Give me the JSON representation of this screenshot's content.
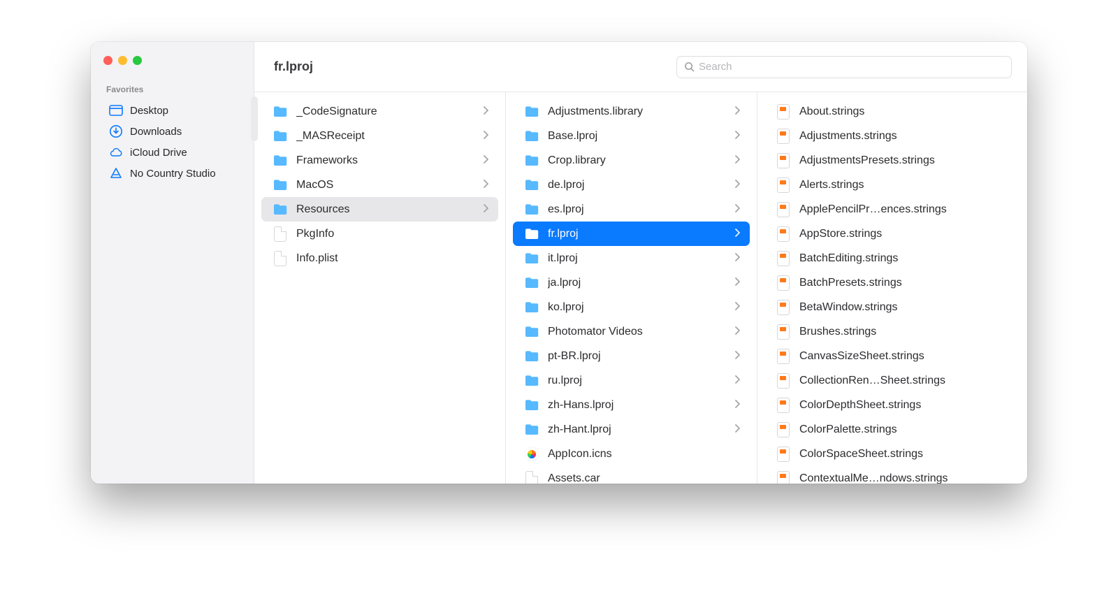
{
  "window_title": "fr.lproj",
  "search": {
    "placeholder": "Search"
  },
  "sidebar": {
    "favorites_label": "Favorites",
    "items": [
      {
        "label": "Desktop",
        "icon": "desktop-icon"
      },
      {
        "label": "Downloads",
        "icon": "downloads-icon"
      },
      {
        "label": "iCloud Drive",
        "icon": "icloud-icon"
      },
      {
        "label": "No Country Studio",
        "icon": "triangle-icon"
      }
    ]
  },
  "columns": [
    {
      "items": [
        {
          "label": "_CodeSignature",
          "kind": "folder",
          "chev": true
        },
        {
          "label": "_MASReceipt",
          "kind": "folder",
          "chev": true
        },
        {
          "label": "Frameworks",
          "kind": "folder",
          "chev": true
        },
        {
          "label": "MacOS",
          "kind": "folder",
          "chev": true
        },
        {
          "label": "Resources",
          "kind": "folder",
          "chev": true,
          "openpath": true
        },
        {
          "label": "PkgInfo",
          "kind": "file"
        },
        {
          "label": "Info.plist",
          "kind": "file"
        }
      ]
    },
    {
      "items": [
        {
          "label": "Adjustments.library",
          "kind": "folder",
          "chev": true
        },
        {
          "label": "Base.lproj",
          "kind": "folder",
          "chev": true
        },
        {
          "label": "Crop.library",
          "kind": "folder",
          "chev": true
        },
        {
          "label": "de.lproj",
          "kind": "folder",
          "chev": true
        },
        {
          "label": "es.lproj",
          "kind": "folder",
          "chev": true
        },
        {
          "label": "fr.lproj",
          "kind": "folder",
          "chev": true,
          "selected": true
        },
        {
          "label": "it.lproj",
          "kind": "folder",
          "chev": true
        },
        {
          "label": "ja.lproj",
          "kind": "folder",
          "chev": true
        },
        {
          "label": "ko.lproj",
          "kind": "folder",
          "chev": true
        },
        {
          "label": "Photomator Videos",
          "kind": "folder",
          "chev": true
        },
        {
          "label": "pt-BR.lproj",
          "kind": "folder",
          "chev": true
        },
        {
          "label": "ru.lproj",
          "kind": "folder",
          "chev": true
        },
        {
          "label": "zh-Hans.lproj",
          "kind": "folder",
          "chev": true
        },
        {
          "label": "zh-Hant.lproj",
          "kind": "folder",
          "chev": true
        },
        {
          "label": "AppIcon.icns",
          "kind": "icns"
        },
        {
          "label": "Assets.car",
          "kind": "file"
        }
      ]
    },
    {
      "items": [
        {
          "label": "About.strings",
          "kind": "strings"
        },
        {
          "label": "Adjustments.strings",
          "kind": "strings"
        },
        {
          "label": "AdjustmentsPresets.strings",
          "kind": "strings"
        },
        {
          "label": "Alerts.strings",
          "kind": "strings"
        },
        {
          "label": "ApplePencilPr…ences.strings",
          "kind": "strings"
        },
        {
          "label": "AppStore.strings",
          "kind": "strings"
        },
        {
          "label": "BatchEditing.strings",
          "kind": "strings"
        },
        {
          "label": "BatchPresets.strings",
          "kind": "strings"
        },
        {
          "label": "BetaWindow.strings",
          "kind": "strings"
        },
        {
          "label": "Brushes.strings",
          "kind": "strings"
        },
        {
          "label": "CanvasSizeSheet.strings",
          "kind": "strings"
        },
        {
          "label": "CollectionRen…Sheet.strings",
          "kind": "strings"
        },
        {
          "label": "ColorDepthSheet.strings",
          "kind": "strings"
        },
        {
          "label": "ColorPalette.strings",
          "kind": "strings"
        },
        {
          "label": "ColorSpaceSheet.strings",
          "kind": "strings"
        },
        {
          "label": "ContextualMe…ndows.strings",
          "kind": "strings"
        }
      ]
    }
  ]
}
